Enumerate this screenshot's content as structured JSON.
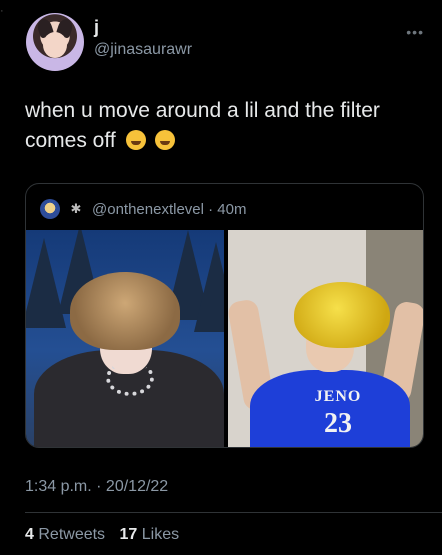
{
  "tweet": {
    "display_name": "j",
    "handle": "@jinasaurawr",
    "text": "when u move around a lil and the filter comes off",
    "emojis": [
      "rolling-on-floor-laughing",
      "weary-face"
    ],
    "timestamp": "1:34 p.m. · 20/12/22",
    "retweets_count": "4",
    "retweets_label": "Retweets",
    "likes_count": "17",
    "likes_label": "Likes",
    "more_icon": "ellipsis-icon"
  },
  "quote": {
    "handle_time": "@onthenextlevel · 40m",
    "jersey_name": "JENO",
    "jersey_number": "23"
  },
  "colors": {
    "background": "#000000",
    "text": "#e7e9ea",
    "secondary": "#8b98a5",
    "border": "#2f3336"
  }
}
